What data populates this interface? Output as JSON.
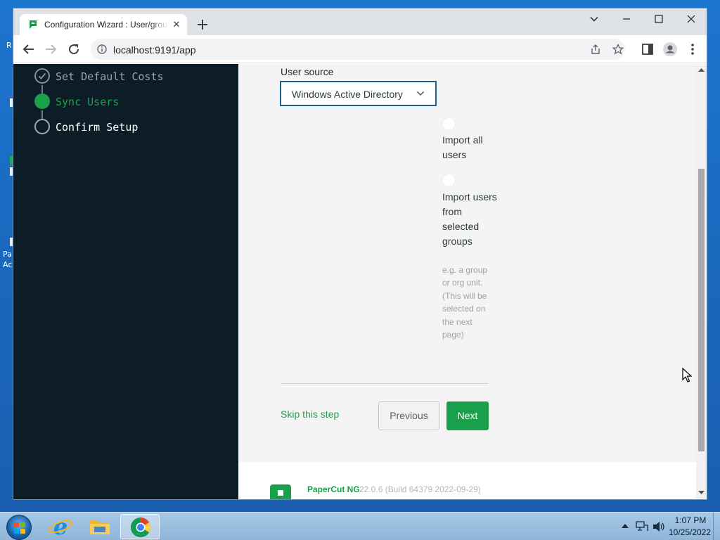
{
  "desktop": {
    "left_fragments": [
      "R",
      "I",
      "I",
      "I",
      "Pa",
      "Ac"
    ]
  },
  "browser": {
    "tab": {
      "title": "Configuration Wizard : User/group sync",
      "close_glyph": "✕"
    },
    "address": {
      "url": "localhost:9191/app"
    }
  },
  "wizard": {
    "steps": [
      {
        "label": "Set Default Costs",
        "state": "done"
      },
      {
        "label": "Sync Users",
        "state": "current"
      },
      {
        "label": "Confirm Setup",
        "state": "pending"
      }
    ],
    "form": {
      "user_source_label": "User source",
      "user_source_value": "Windows Active Directory",
      "option_all": "Import all users",
      "option_groups": "Import users from selected groups",
      "option_groups_hint": "e.g. a group or org unit. (This will be selected on the next page)"
    },
    "actions": {
      "skip": "Skip this step",
      "previous": "Previous",
      "next": "Next"
    },
    "footer": {
      "brand": "PaperCut NG",
      "version": "22.0.6 (Build 64379 2022-09-29)"
    }
  },
  "taskbar": {
    "time": "1:07 PM",
    "date": "10/25/2022"
  },
  "colors": {
    "accent_green": "#1a9f4b",
    "sidebar_bg": "#0d1d27",
    "select_border": "#1b5f8a"
  }
}
